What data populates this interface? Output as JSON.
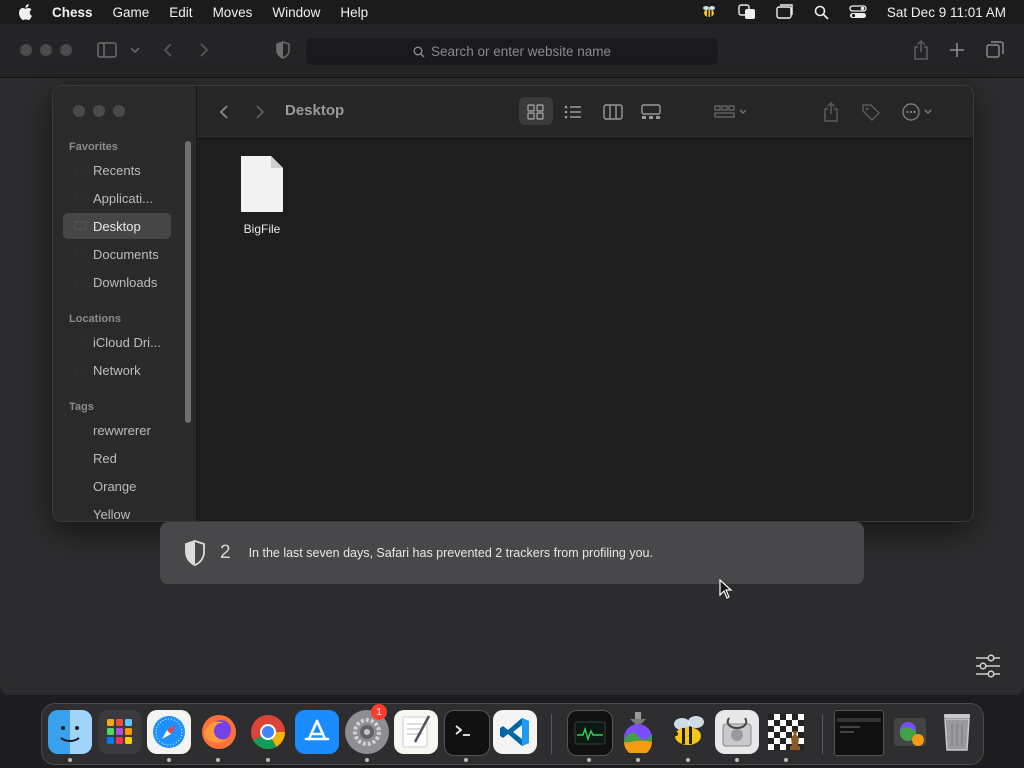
{
  "menubar": {
    "app_name": "Chess",
    "items": [
      "Game",
      "Edit",
      "Moves",
      "Window",
      "Help"
    ],
    "clock": "Sat Dec 9  11:01 AM"
  },
  "safari": {
    "address_placeholder": "Search or enter website name",
    "privacy_count": "2",
    "privacy_message": "In the last seven days, Safari has prevented 2 trackers from profiling you."
  },
  "finder": {
    "title": "Desktop",
    "sections": {
      "favorites": "Favorites",
      "locations": "Locations",
      "tags": "Tags"
    },
    "favorites": [
      "Recents",
      "Applicati...",
      "Desktop",
      "Documents",
      "Downloads"
    ],
    "locations": [
      "iCloud Dri...",
      "Network"
    ],
    "tags": [
      "rewwrerer",
      "Red",
      "Orange",
      "Yellow"
    ],
    "file_name": "BigFile"
  },
  "dock": {
    "settings_badge": "1"
  }
}
